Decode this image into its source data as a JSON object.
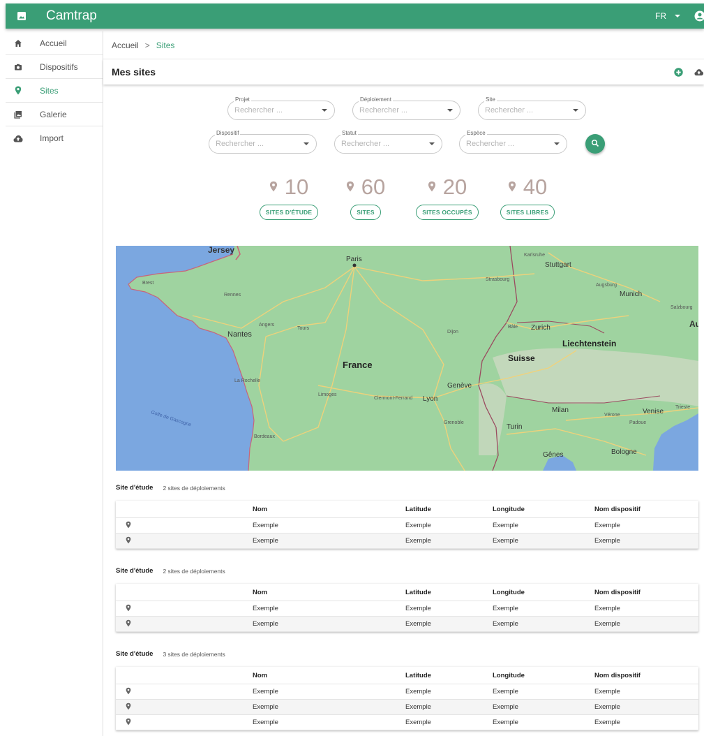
{
  "app": {
    "title": "Camtrap",
    "language": "FR"
  },
  "sidebar": {
    "items": [
      {
        "label": "Accueil",
        "icon": "home-icon"
      },
      {
        "label": "Dispositifs",
        "icon": "camera-icon"
      },
      {
        "label": "Sites",
        "icon": "map-pin-icon",
        "active": true
      },
      {
        "label": "Galerie",
        "icon": "gallery-icon"
      },
      {
        "label": "Import",
        "icon": "cloud-upload-icon"
      }
    ]
  },
  "breadcrumb": {
    "home": "Accueil",
    "separator": ">",
    "current": "Sites"
  },
  "page": {
    "title": "Mes sites"
  },
  "filters": [
    {
      "label": "Projet",
      "placeholder": "Rechercher ..."
    },
    {
      "label": "Déploiement",
      "placeholder": "Rechercher ..."
    },
    {
      "label": "Site",
      "placeholder": "Rechercher ..."
    },
    {
      "label": "Dispositif",
      "placeholder": "Rechercher ..."
    },
    {
      "label": "Statut",
      "placeholder": "Rechercher ..."
    },
    {
      "label": "Espèce",
      "placeholder": "Rechercher ..."
    }
  ],
  "stats": [
    {
      "value": "10",
      "label": "SITES D'ÉTUDE"
    },
    {
      "value": "60",
      "label": "SITES"
    },
    {
      "value": "20",
      "label": "SITES OCCUPÉS"
    },
    {
      "value": "40",
      "label": "SITES LIBRES"
    }
  ],
  "map": {
    "labels": {
      "jersey": "Jersey",
      "paris": "Paris",
      "brest": "Brest",
      "rennes": "Rennes",
      "nantes": "Nantes",
      "angers": "Angers",
      "tours": "Tours",
      "france": "France",
      "larochelle": "La Rochelle",
      "limoges": "Limoges",
      "clermont": "Clermont-Ferrand",
      "lyon": "Lyon",
      "geneve": "Genève",
      "grenoble": "Grenoble",
      "bordeaux": "Bordeaux",
      "golfe": "Golfe de Gascogne",
      "dijon": "Dijon",
      "strasbourg": "Strasbourg",
      "karlsruhe": "Karlsruhe",
      "stuttgart": "Stuttgart",
      "augsburg": "Augsburg",
      "munich": "Munich",
      "salzbourg": "Salzbourg",
      "au": "Au",
      "bale": "Bâle",
      "zurich": "Zurich",
      "liechtenstein": "Liechtenstein",
      "suisse": "Suisse",
      "milan": "Milan",
      "turin": "Turin",
      "verone": "Vérone",
      "venise": "Venise",
      "padoue": "Padoue",
      "trieste": "Trieste",
      "genes": "Gênes",
      "bologne": "Bologne"
    }
  },
  "tables": [
    {
      "title": "Site d'étude",
      "count": "2 sites de déploiements",
      "columns": [
        "Nom",
        "Latitude",
        "Longitude",
        "Nom dispositif"
      ],
      "rows": [
        [
          "Exemple",
          "Exemple",
          "Exemple",
          "Exemple"
        ],
        [
          "Exemple",
          "Exemple",
          "Exemple",
          "Exemple"
        ]
      ]
    },
    {
      "title": "Site d'étude",
      "count": "2 sites de déploiements",
      "columns": [
        "Nom",
        "Latitude",
        "Longitude",
        "Nom dispositif"
      ],
      "rows": [
        [
          "Exemple",
          "Exemple",
          "Exemple",
          "Exemple"
        ],
        [
          "Exemple",
          "Exemple",
          "Exemple",
          "Exemple"
        ]
      ]
    },
    {
      "title": "Site d'étude",
      "count": "3 sites de déploiements",
      "columns": [
        "Nom",
        "Latitude",
        "Longitude",
        "Nom dispositif"
      ],
      "rows": [
        [
          "Exemple",
          "Exemple",
          "Exemple",
          "Exemple"
        ],
        [
          "Exemple",
          "Exemple",
          "Exemple",
          "Exemple"
        ],
        [
          "Exemple",
          "Exemple",
          "Exemple",
          "Exemple"
        ]
      ]
    }
  ],
  "colors": {
    "primary": "#3a9e76",
    "stat_number": "#b7a49f",
    "sea": "#7ba7e0",
    "land": "#9fd3a0"
  }
}
